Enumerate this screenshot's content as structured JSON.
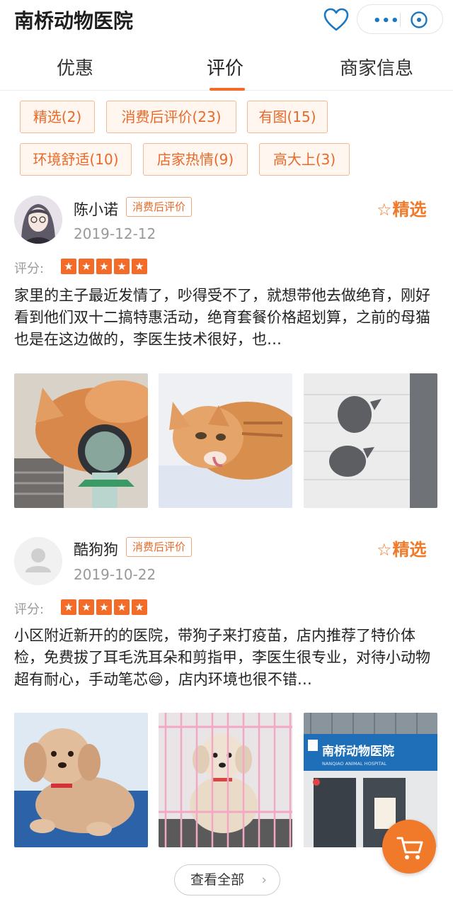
{
  "header": {
    "title": "南桥动物医院"
  },
  "tabs": [
    {
      "label": "优惠"
    },
    {
      "label": "评价"
    },
    {
      "label": "商家信息"
    }
  ],
  "tags": [
    {
      "label": "精选(2)"
    },
    {
      "label": "消费后评价(23)"
    },
    {
      "label": "有图(15)"
    },
    {
      "label": "环境舒适(10)"
    },
    {
      "label": "店家热情(9)"
    },
    {
      "label": "高大上(3)"
    }
  ],
  "reviews": [
    {
      "user": "陈小诺",
      "badge": "消费后评价",
      "date": "2019-12-12",
      "featured": "精选",
      "score_label": "评分:",
      "rating": 5,
      "text": "家里的主子最近发情了，吵得受不了，就想带他去做绝育，刚好看到他们双十二搞特惠活动，绝育套餐价格超划算，之前的母猫也是在这边做的，李医生技术很好，也…"
    },
    {
      "user": "酷狗狗",
      "badge": "消费后评价",
      "date": "2019-10-22",
      "featured": "精选",
      "score_label": "评分:",
      "rating": 5,
      "text": "小区附近新开的的医院，带狗子来打疫苗，店内推荐了特价体检，免费拔了耳毛洗耳朵和剪指甲，李医生很专业，对待小动物超有耐心，手动笔芯😄，店内环境也很不错…"
    }
  ],
  "store_sign": {
    "name": "南桥动物医院",
    "english": "NANQIAO ANIMAL HOSPITAL"
  },
  "footer": {
    "see_all": "查看全部"
  },
  "colors": {
    "accent": "#f26b29",
    "blue": "#1a78c2"
  }
}
